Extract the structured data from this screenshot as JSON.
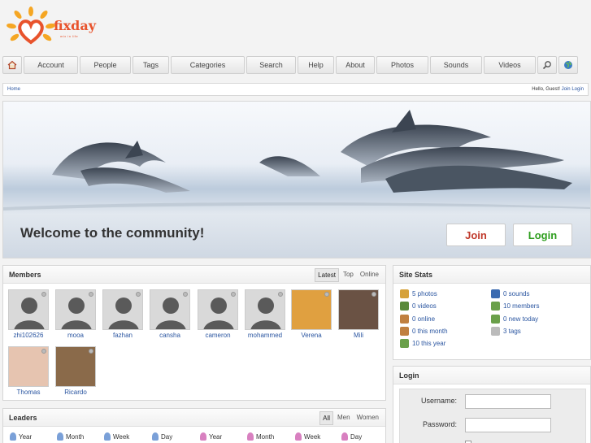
{
  "brand": {
    "name": "fixday",
    "tagline": "mix in life"
  },
  "nav": {
    "tabs": [
      "Account",
      "People",
      "Tags",
      "Categories",
      "Search",
      "Help",
      "About",
      "Photos",
      "Sounds",
      "Videos"
    ]
  },
  "breadcrumb": {
    "home": "Home",
    "greeting": "Hello, Guest!",
    "join": "Join",
    "login": "Login"
  },
  "banner": {
    "welcome": "Welcome to the community!",
    "join_label": "Join",
    "login_label": "Login"
  },
  "members": {
    "title": "Members",
    "tabs": [
      "Latest",
      "Top",
      "Online"
    ],
    "list": [
      "zhi102626",
      "mooa",
      "fazhan",
      "cansha",
      "cameron",
      "mohammed",
      "Verena",
      "Mili",
      "Thomas",
      "Ricardo"
    ]
  },
  "stats": {
    "title": "Site Stats",
    "left": [
      "5 photos",
      "0 videos",
      "0 online",
      "0 this month",
      "10 this year"
    ],
    "right": [
      "0 sounds",
      "10 members",
      "0 new today",
      "3 tags"
    ]
  },
  "login": {
    "title": "Login",
    "username_label": "Username:",
    "password_label": "Password:"
  },
  "leaders": {
    "title": "Leaders",
    "tabs": [
      "All",
      "Men",
      "Women"
    ],
    "periods": [
      "Year",
      "Month",
      "Week",
      "Day",
      "Year",
      "Month",
      "Week",
      "Day"
    ]
  },
  "colors": {
    "brand": "#e8532c",
    "link": "#2a55a0",
    "join": "#c0392b",
    "login": "#2e9e1e"
  }
}
